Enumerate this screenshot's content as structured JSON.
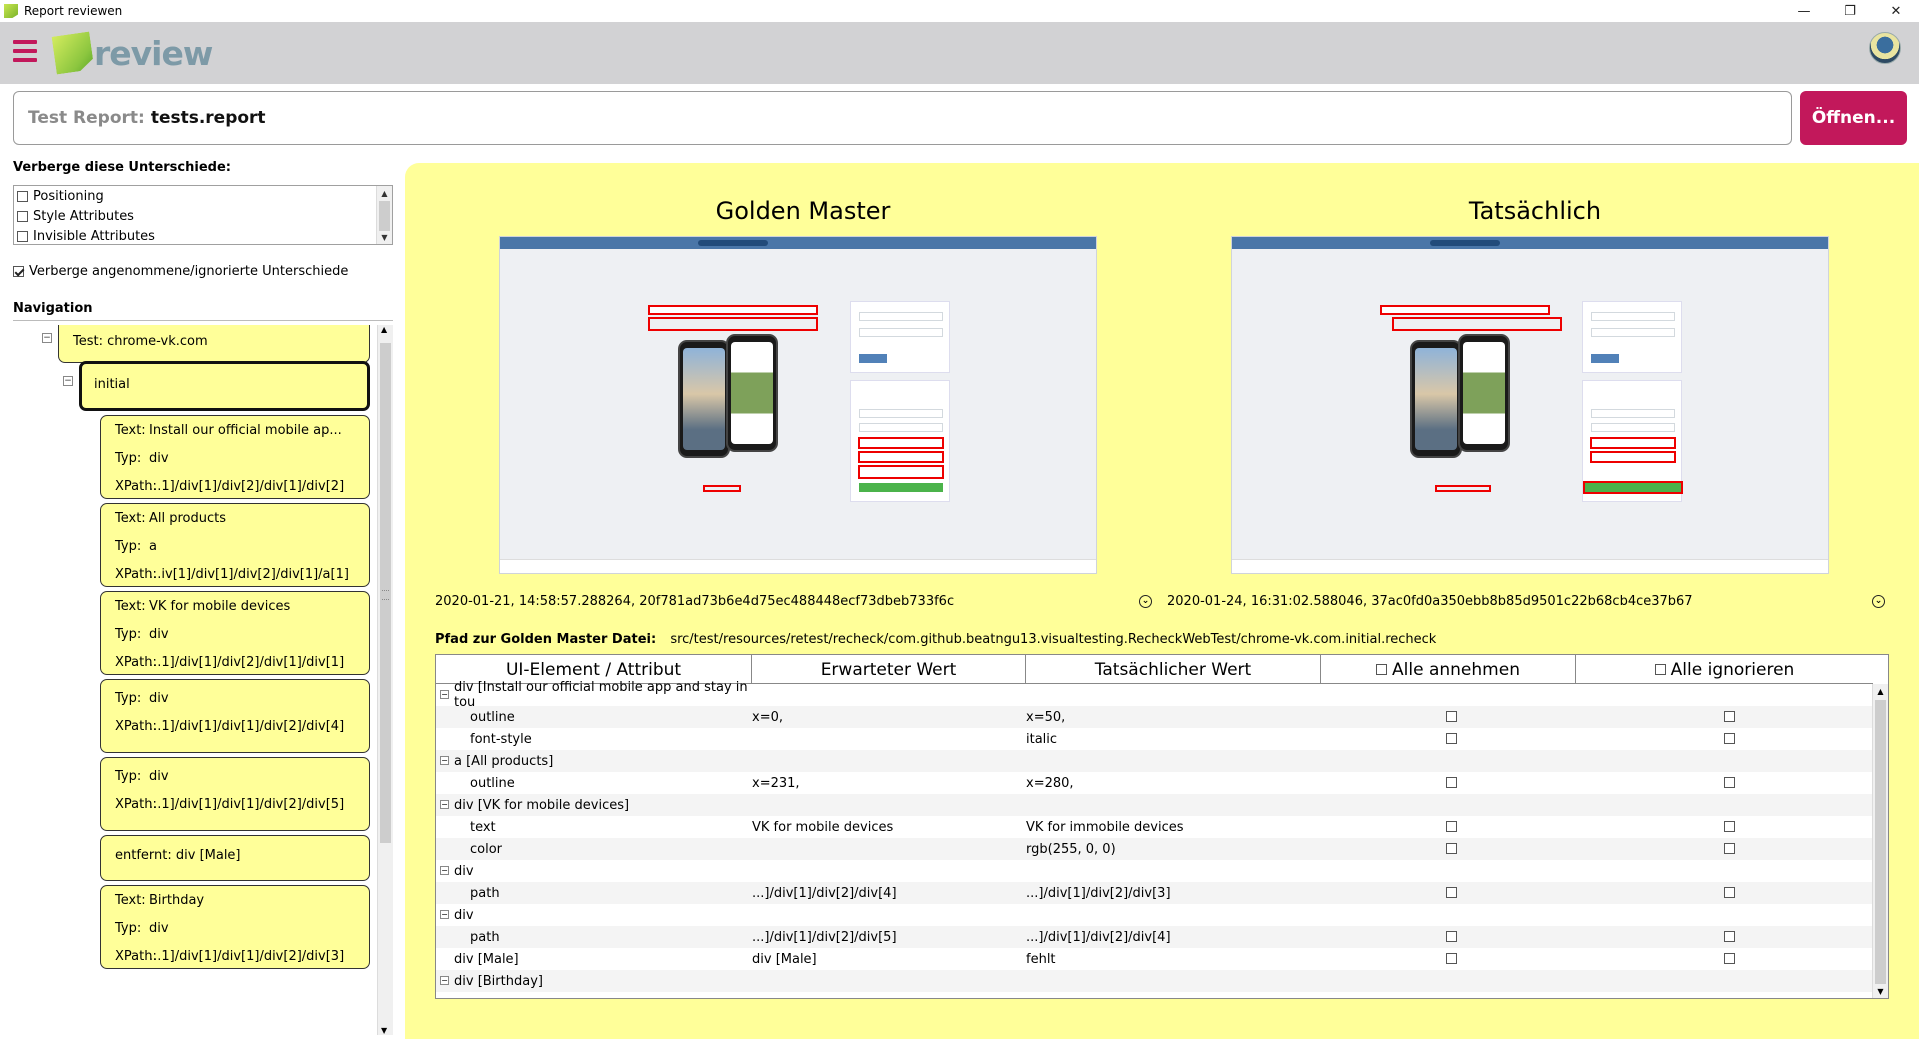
{
  "window": {
    "title": "Report reviewen",
    "controls": [
      "—",
      "❐",
      "✕"
    ]
  },
  "header": {
    "logo_text": "review"
  },
  "report": {
    "label": "Test Report:",
    "value": "tests.report",
    "open_button": "Öffnen..."
  },
  "filters": {
    "title": "Verberge diese Unterschiede:",
    "items": [
      {
        "label": "Positioning",
        "checked": false
      },
      {
        "label": "Style Attributes",
        "checked": false
      },
      {
        "label": "Invisible Attributes",
        "checked": false
      }
    ],
    "hide_accepted": {
      "label": "Verberge angenommene/ignorierte Unterschiede",
      "checked": true
    }
  },
  "navigation": {
    "title": "Navigation",
    "test": "Test: chrome-vk.com",
    "initial": "initial",
    "labels": {
      "text": "Text:",
      "type": "Typ:",
      "xpath": "XPath:"
    },
    "items": [
      {
        "text": "Install our official mobile ap...",
        "type": "div",
        "xpath": "...1]/div[1]/div[2]/div[1]/div[2]"
      },
      {
        "text": "All products",
        "type": "a",
        "xpath": "...iv[1]/div[1]/div[2]/div[1]/a[1]"
      },
      {
        "text": "VK for mobile devices",
        "type": "div",
        "xpath": "...1]/div[1]/div[2]/div[1]/div[1]"
      },
      {
        "type": "div",
        "xpath": "...1]/div[1]/div[1]/div[2]/div[4]"
      },
      {
        "type": "div",
        "xpath": "...1]/div[1]/div[1]/div[2]/div[5]"
      },
      {
        "removed": "entfernt: div [Male]"
      },
      {
        "text": "Birthday",
        "type": "div",
        "xpath": "...1]/div[1]/div[1]/div[2]/div[3]"
      }
    ]
  },
  "main": {
    "golden_title": "Golden Master",
    "actual_title": "Tatsächlich",
    "golden_meta": "2020-01-21, 14:58:57.288264, 20f781ad73b6e4d75ec488448ecf73dbeb733f6c",
    "actual_meta": "2020-01-24, 16:31:02.588046, 37ac0fd0a350ebb8b85d9501c22b68cb4ce37b67",
    "gm_path_label": "Pfad zur Golden Master Datei:",
    "gm_path_value": "src/test/resources/retest/recheck/com.github.beatngu13.visualtesting.RecheckWebTest/chrome-vk.com.initial.recheck"
  },
  "table": {
    "headers": {
      "element": "UI-Element / Attribut",
      "expected": "Erwarteter Wert",
      "actual": "Tatsächlicher Wert",
      "accept_all": "Alle annehmen",
      "ignore_all": "Alle ignorieren"
    },
    "rows": [
      {
        "name": "div [Install our official mobile app and stay in tou",
        "group": true
      },
      {
        "name": "outline",
        "expected": "x=0,",
        "actual": "x=50,"
      },
      {
        "name": "font-style",
        "expected": "",
        "actual": "italic"
      },
      {
        "name": "a [All products]",
        "group": true
      },
      {
        "name": "outline",
        "expected": "x=231,",
        "actual": "x=280,"
      },
      {
        "name": "div [VK for mobile devices]",
        "group": true
      },
      {
        "name": "text",
        "expected": "VK for mobile devices",
        "actual": "VK for immobile devices"
      },
      {
        "name": "color",
        "expected": "",
        "actual": "rgb(255, 0, 0)"
      },
      {
        "name": "div",
        "group": true
      },
      {
        "name": "path",
        "expected": "...]/div[1]/div[2]/div[4]",
        "actual": "...]/div[1]/div[2]/div[3]"
      },
      {
        "name": "div",
        "group": true
      },
      {
        "name": "path",
        "expected": "...]/div[1]/div[2]/div[5]",
        "actual": "...]/div[1]/div[2]/div[4]"
      },
      {
        "name": "div [Male]",
        "expected": "div [Male]",
        "actual": "fehlt",
        "flat": true
      },
      {
        "name": "div [Birthday]",
        "group": true
      }
    ]
  }
}
